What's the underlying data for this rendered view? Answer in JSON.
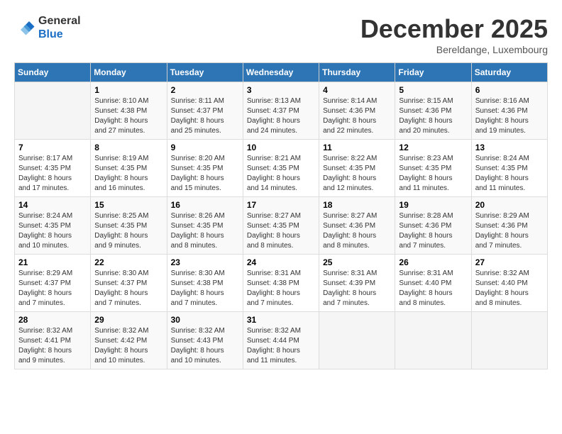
{
  "logo": {
    "general": "General",
    "blue": "Blue"
  },
  "title": "December 2025",
  "location": "Bereldange, Luxembourg",
  "days_header": [
    "Sunday",
    "Monday",
    "Tuesday",
    "Wednesday",
    "Thursday",
    "Friday",
    "Saturday"
  ],
  "weeks": [
    [
      {
        "day": "",
        "info": ""
      },
      {
        "day": "1",
        "info": "Sunrise: 8:10 AM\nSunset: 4:38 PM\nDaylight: 8 hours\nand 27 minutes."
      },
      {
        "day": "2",
        "info": "Sunrise: 8:11 AM\nSunset: 4:37 PM\nDaylight: 8 hours\nand 25 minutes."
      },
      {
        "day": "3",
        "info": "Sunrise: 8:13 AM\nSunset: 4:37 PM\nDaylight: 8 hours\nand 24 minutes."
      },
      {
        "day": "4",
        "info": "Sunrise: 8:14 AM\nSunset: 4:36 PM\nDaylight: 8 hours\nand 22 minutes."
      },
      {
        "day": "5",
        "info": "Sunrise: 8:15 AM\nSunset: 4:36 PM\nDaylight: 8 hours\nand 20 minutes."
      },
      {
        "day": "6",
        "info": "Sunrise: 8:16 AM\nSunset: 4:36 PM\nDaylight: 8 hours\nand 19 minutes."
      }
    ],
    [
      {
        "day": "7",
        "info": "Sunrise: 8:17 AM\nSunset: 4:35 PM\nDaylight: 8 hours\nand 17 minutes."
      },
      {
        "day": "8",
        "info": "Sunrise: 8:19 AM\nSunset: 4:35 PM\nDaylight: 8 hours\nand 16 minutes."
      },
      {
        "day": "9",
        "info": "Sunrise: 8:20 AM\nSunset: 4:35 PM\nDaylight: 8 hours\nand 15 minutes."
      },
      {
        "day": "10",
        "info": "Sunrise: 8:21 AM\nSunset: 4:35 PM\nDaylight: 8 hours\nand 14 minutes."
      },
      {
        "day": "11",
        "info": "Sunrise: 8:22 AM\nSunset: 4:35 PM\nDaylight: 8 hours\nand 12 minutes."
      },
      {
        "day": "12",
        "info": "Sunrise: 8:23 AM\nSunset: 4:35 PM\nDaylight: 8 hours\nand 11 minutes."
      },
      {
        "day": "13",
        "info": "Sunrise: 8:24 AM\nSunset: 4:35 PM\nDaylight: 8 hours\nand 11 minutes."
      }
    ],
    [
      {
        "day": "14",
        "info": "Sunrise: 8:24 AM\nSunset: 4:35 PM\nDaylight: 8 hours\nand 10 minutes."
      },
      {
        "day": "15",
        "info": "Sunrise: 8:25 AM\nSunset: 4:35 PM\nDaylight: 8 hours\nand 9 minutes."
      },
      {
        "day": "16",
        "info": "Sunrise: 8:26 AM\nSunset: 4:35 PM\nDaylight: 8 hours\nand 8 minutes."
      },
      {
        "day": "17",
        "info": "Sunrise: 8:27 AM\nSunset: 4:35 PM\nDaylight: 8 hours\nand 8 minutes."
      },
      {
        "day": "18",
        "info": "Sunrise: 8:27 AM\nSunset: 4:36 PM\nDaylight: 8 hours\nand 8 minutes."
      },
      {
        "day": "19",
        "info": "Sunrise: 8:28 AM\nSunset: 4:36 PM\nDaylight: 8 hours\nand 7 minutes."
      },
      {
        "day": "20",
        "info": "Sunrise: 8:29 AM\nSunset: 4:36 PM\nDaylight: 8 hours\nand 7 minutes."
      }
    ],
    [
      {
        "day": "21",
        "info": "Sunrise: 8:29 AM\nSunset: 4:37 PM\nDaylight: 8 hours\nand 7 minutes."
      },
      {
        "day": "22",
        "info": "Sunrise: 8:30 AM\nSunset: 4:37 PM\nDaylight: 8 hours\nand 7 minutes."
      },
      {
        "day": "23",
        "info": "Sunrise: 8:30 AM\nSunset: 4:38 PM\nDaylight: 8 hours\nand 7 minutes."
      },
      {
        "day": "24",
        "info": "Sunrise: 8:31 AM\nSunset: 4:38 PM\nDaylight: 8 hours\nand 7 minutes."
      },
      {
        "day": "25",
        "info": "Sunrise: 8:31 AM\nSunset: 4:39 PM\nDaylight: 8 hours\nand 7 minutes."
      },
      {
        "day": "26",
        "info": "Sunrise: 8:31 AM\nSunset: 4:40 PM\nDaylight: 8 hours\nand 8 minutes."
      },
      {
        "day": "27",
        "info": "Sunrise: 8:32 AM\nSunset: 4:40 PM\nDaylight: 8 hours\nand 8 minutes."
      }
    ],
    [
      {
        "day": "28",
        "info": "Sunrise: 8:32 AM\nSunset: 4:41 PM\nDaylight: 8 hours\nand 9 minutes."
      },
      {
        "day": "29",
        "info": "Sunrise: 8:32 AM\nSunset: 4:42 PM\nDaylight: 8 hours\nand 10 minutes."
      },
      {
        "day": "30",
        "info": "Sunrise: 8:32 AM\nSunset: 4:43 PM\nDaylight: 8 hours\nand 10 minutes."
      },
      {
        "day": "31",
        "info": "Sunrise: 8:32 AM\nSunset: 4:44 PM\nDaylight: 8 hours\nand 11 minutes."
      },
      {
        "day": "",
        "info": ""
      },
      {
        "day": "",
        "info": ""
      },
      {
        "day": "",
        "info": ""
      }
    ]
  ]
}
